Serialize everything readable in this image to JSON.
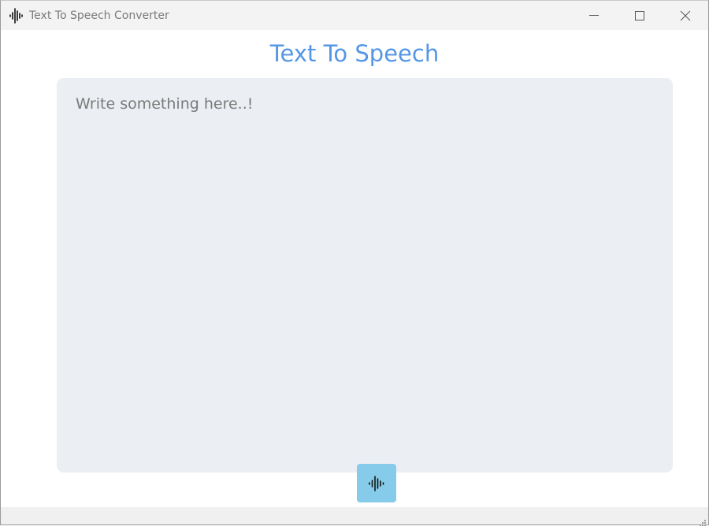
{
  "window": {
    "title": "Text To Speech Converter",
    "app_icon": "sound-wave-icon"
  },
  "controls": {
    "minimize_icon": "minimize-icon",
    "maximize_icon": "maximize-icon",
    "close_icon": "close-icon"
  },
  "main": {
    "heading": "Text To Speech",
    "input_value": "",
    "input_placeholder": "Write something here..!",
    "speak_button_icon": "sound-wave-icon"
  },
  "colors": {
    "heading": "#5596e6",
    "input_background": "#ebeef2",
    "speak_button": "#86cbe9",
    "titlebar": "#f3f3f3"
  }
}
